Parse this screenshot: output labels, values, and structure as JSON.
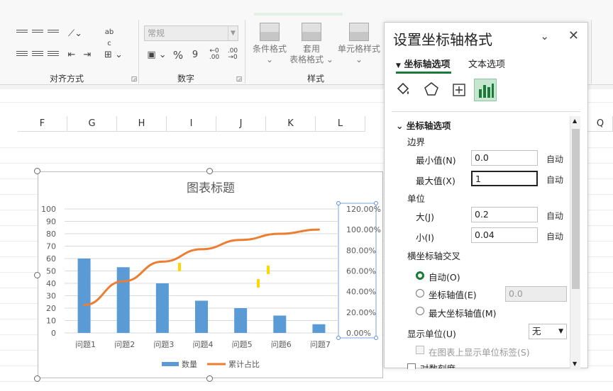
{
  "ribbon": {
    "groups": {
      "alignment": "对齐方式",
      "number": "数字",
      "styles": "样式"
    },
    "number_format": "常规",
    "percent_symbol": "%",
    "comma_symbol": "9",
    "wrap_label": "ab c",
    "buttons": {
      "conditional": [
        "条件格式",
        "⌄"
      ],
      "table": [
        "套用",
        "表格格式 ⌄"
      ],
      "cell_style": [
        "单元格样式",
        "⌄"
      ]
    }
  },
  "columns": [
    "F",
    "G",
    "H",
    "I",
    "J",
    "K",
    "L",
    "Q"
  ],
  "chart_data": {
    "type": "bar",
    "title": "图表标题",
    "categories": [
      "问题1",
      "问题2",
      "问题3",
      "问题4",
      "问题5",
      "问题6",
      "问题7"
    ],
    "series": [
      {
        "name": "数量",
        "type": "bar",
        "axis": "left",
        "values": [
          60,
          53,
          40,
          26,
          20,
          14,
          7
        ]
      },
      {
        "name": "累计占比",
        "type": "line",
        "axis": "right",
        "values": [
          0.27,
          0.5,
          0.69,
          0.81,
          0.9,
          0.96,
          1.0
        ]
      }
    ],
    "y_left": {
      "min": 0,
      "max": 100,
      "step": 10,
      "ticks": [
        "0",
        "10",
        "20",
        "30",
        "40",
        "50",
        "60",
        "70",
        "80",
        "90",
        "100"
      ]
    },
    "y_right": {
      "min": 0,
      "max": 1.2,
      "step": 0.2,
      "ticks": [
        "0.00%",
        "20.00%",
        "40.00%",
        "60.00%",
        "80.00%",
        "100.00%",
        "120.00%"
      ]
    },
    "colors": {
      "bar": "#5b9bd5",
      "line": "#ed7d31",
      "marks": "#ffd700"
    },
    "grid": true,
    "legend_position": "bottom"
  },
  "pane": {
    "title": "设置坐标轴格式",
    "tabs": [
      "坐标轴选项",
      "文本选项"
    ],
    "section": "坐标轴选项",
    "bounds_label": "边界",
    "min_label": "最小值(N)",
    "min_value": "0.0",
    "max_label": "最大值(X)",
    "max_value": "1",
    "units_label": "单位",
    "major_label": "大(J)",
    "major_value": "0.2",
    "minor_label": "小(I)",
    "minor_value": "0.04",
    "auto": "自动",
    "cross_label": "横坐标轴交叉",
    "cross_options": [
      "自动(O)",
      "坐标轴值(E)",
      "最大坐标轴值(M)"
    ],
    "cross_value": "0.0",
    "display_units_label": "显示单位(U)",
    "display_units_value": "无",
    "show_units_label": "在图表上显示单位标签(S)",
    "log_scale_label": "对数刻度"
  }
}
